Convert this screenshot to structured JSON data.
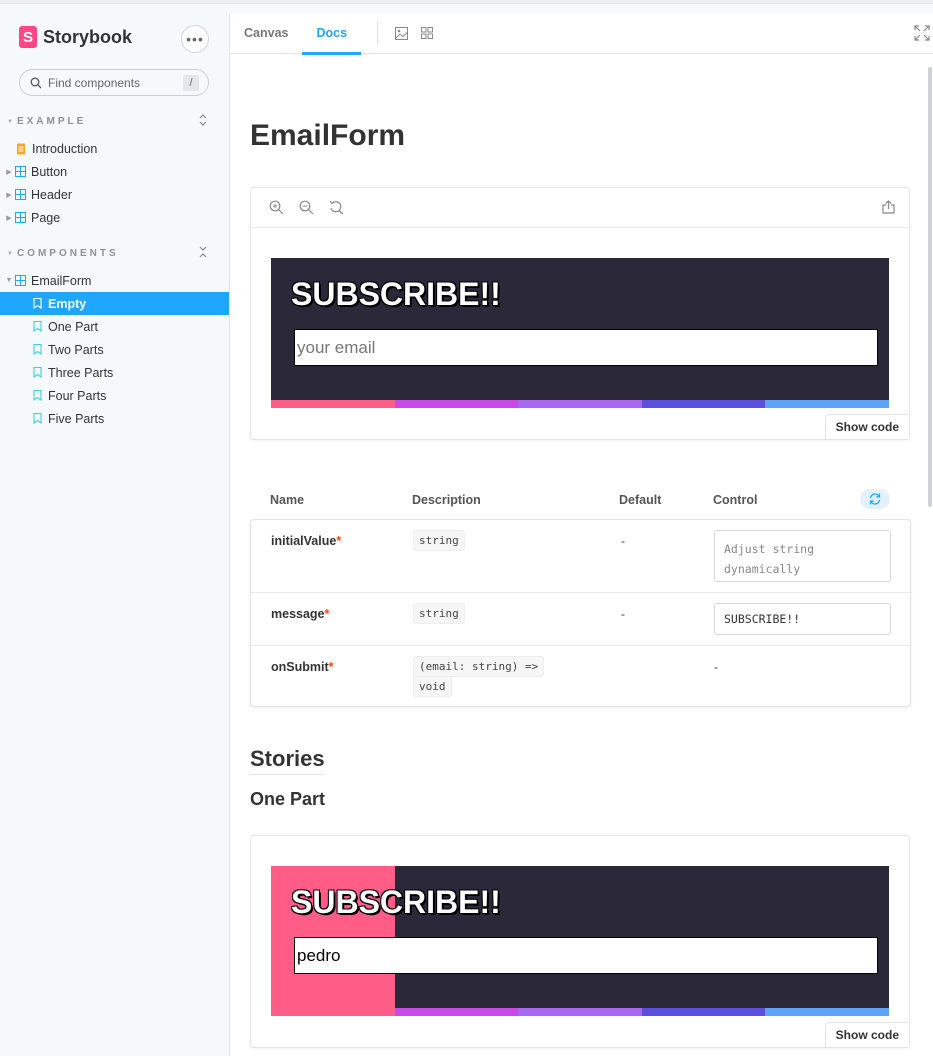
{
  "brand": {
    "name": "Storybook",
    "logo_letter": "S",
    "accent": "#ff4785"
  },
  "sidebar": {
    "search_placeholder": "Find components",
    "search_shortcut": "/",
    "sections": [
      {
        "title": "EXAMPLE",
        "items": [
          "Introduction",
          "Button",
          "Header",
          "Page"
        ]
      },
      {
        "title": "COMPONENTS",
        "component": "EmailForm",
        "stories": [
          "Empty",
          "One Part",
          "Two Parts",
          "Three Parts",
          "Four Parts",
          "Five Parts"
        ]
      }
    ],
    "active_story": "Empty",
    "active_color": "#1ea7fd"
  },
  "toolbar": {
    "tabs": [
      "Canvas",
      "Docs"
    ],
    "active_tab": "Docs"
  },
  "docs": {
    "title": "EmailForm",
    "primary_story": {
      "heading": "SUBSCRIBE!!",
      "input_placeholder": "your email",
      "input_value": ""
    },
    "show_code_label": "Show code",
    "stripe_colors": [
      "#ff5c87",
      "#c849e6",
      "#a966f0",
      "#5b4fe0",
      "#5ea3f7"
    ],
    "args_table": {
      "headers": [
        "Name",
        "Description",
        "Default",
        "Control"
      ],
      "rows": [
        {
          "name": "initialValue",
          "required": "*",
          "type": "string",
          "default": "-",
          "control_placeholder": "Adjust string dynamically",
          "control_value": ""
        },
        {
          "name": "message",
          "required": "*",
          "type": "string",
          "default": "-",
          "control_value": "SUBSCRIBE!!"
        },
        {
          "name": "onSubmit",
          "required": "*",
          "type_line1": "(email: string) =>",
          "type_line2": "void",
          "control_value": "-"
        }
      ]
    },
    "stories_heading": "Stories",
    "story_one": {
      "title": "One Part",
      "heading": "SUBSCRIBE!!",
      "input_value": "pedro"
    }
  }
}
